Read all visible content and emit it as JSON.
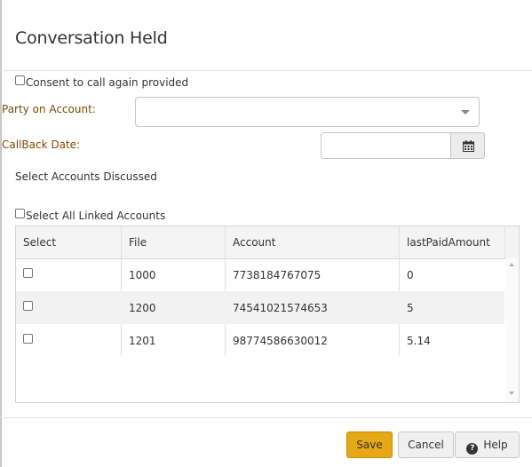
{
  "dialog": {
    "title": "Conversation Held"
  },
  "form": {
    "consent_label": "Consent to call again provided",
    "party_label": "Party on Account:",
    "party_value": "",
    "callback_label": "CallBack Date:",
    "callback_value": "",
    "accounts_heading": "Select Accounts Discussed",
    "select_all_label": "Select All Linked Accounts"
  },
  "grid": {
    "columns": [
      "Select",
      "File",
      "Account",
      "lastPaidAmount"
    ],
    "rows": [
      {
        "file": "1000",
        "account": "7738184767075",
        "last_paid": "0"
      },
      {
        "file": "1200",
        "account": "74541021574653",
        "last_paid": "5"
      },
      {
        "file": "1201",
        "account": "98774586630012",
        "last_paid": "5.14"
      }
    ]
  },
  "buttons": {
    "save": "Save",
    "cancel": "Cancel",
    "help": "Help"
  },
  "icons": {
    "dropdown": "chevron-down-icon",
    "calendar": "calendar-icon",
    "help": "question-circle-icon"
  },
  "colors": {
    "accent": "#e6a817",
    "field_label": "#7a4b00"
  }
}
